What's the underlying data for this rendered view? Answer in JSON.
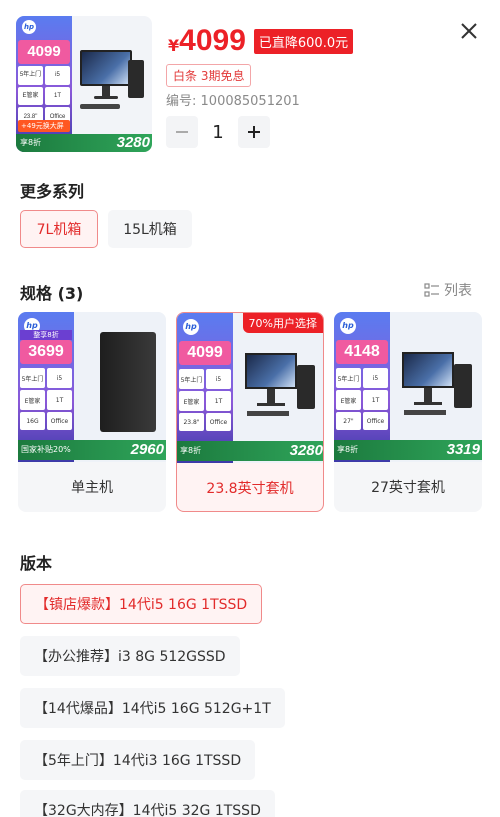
{
  "product": {
    "currency_symbol": "¥",
    "price": "4099",
    "discount_badge": "已直降600.0元",
    "installment": "白条 3期免息",
    "sku_label": "编号:",
    "sku_code": "100085051201",
    "quantity": "1",
    "image": {
      "price": "4099",
      "specs": [
        "5年上门",
        "i5",
        "E管家",
        "1T",
        "23.8\"",
        "Office"
      ],
      "bonus": "+49元换大屏",
      "deal": "享8折",
      "final_price": "3280"
    }
  },
  "series": {
    "title": "更多系列",
    "options": [
      {
        "label": "7L机箱",
        "active": true
      },
      {
        "label": "15L机箱",
        "active": false
      }
    ]
  },
  "specs": {
    "title": "规格 (3)",
    "list_view_label": "列表",
    "cards": [
      {
        "label": "单主机",
        "active": false,
        "ribbon": "",
        "image": {
          "badge": "整享8折",
          "price": "3699",
          "grid": [
            "5年上门",
            "i5",
            "E管家",
            "1T",
            "16G",
            "Office"
          ],
          "bottom": "国家补贴20%",
          "final_price": "2960"
        }
      },
      {
        "label": "23.8英寸套机",
        "active": true,
        "ribbon": "70%用户选择",
        "image": {
          "price": "4099",
          "grid": [
            "5年上门",
            "i5",
            "E管家",
            "1T",
            "23.8\"",
            "Office"
          ],
          "bottom": "享8折",
          "final_price": "3280"
        }
      },
      {
        "label": "27英寸套机",
        "active": false,
        "ribbon": "",
        "image": {
          "price": "4148",
          "grid": [
            "5年上门",
            "i5",
            "E管家",
            "1T",
            "27\"",
            "Office"
          ],
          "bottom": "享8折",
          "final_price": "3319"
        }
      }
    ]
  },
  "version": {
    "title": "版本",
    "options": [
      {
        "label": "【镇店爆款】14代i5 16G 1TSSD",
        "active": true
      },
      {
        "label": "【办公推荐】i3 8G 512GSSD",
        "active": false
      },
      {
        "label": "【14代爆品】14代i5 16G 512G+1T",
        "active": false
      },
      {
        "label": "【5年上门】14代i3 16G 1TSSD",
        "active": false
      },
      {
        "label": "【32G大内存】14代i5 32G 1TSSD",
        "active": false
      }
    ]
  },
  "colors": {
    "accent": "#ec2127",
    "chip_bg": "#f5f6f8",
    "active_bg": "#fff3f3"
  },
  "icons": {
    "close": "close-icon",
    "list": "list-view-icon",
    "minus": "minus-icon",
    "plus": "plus-icon"
  }
}
